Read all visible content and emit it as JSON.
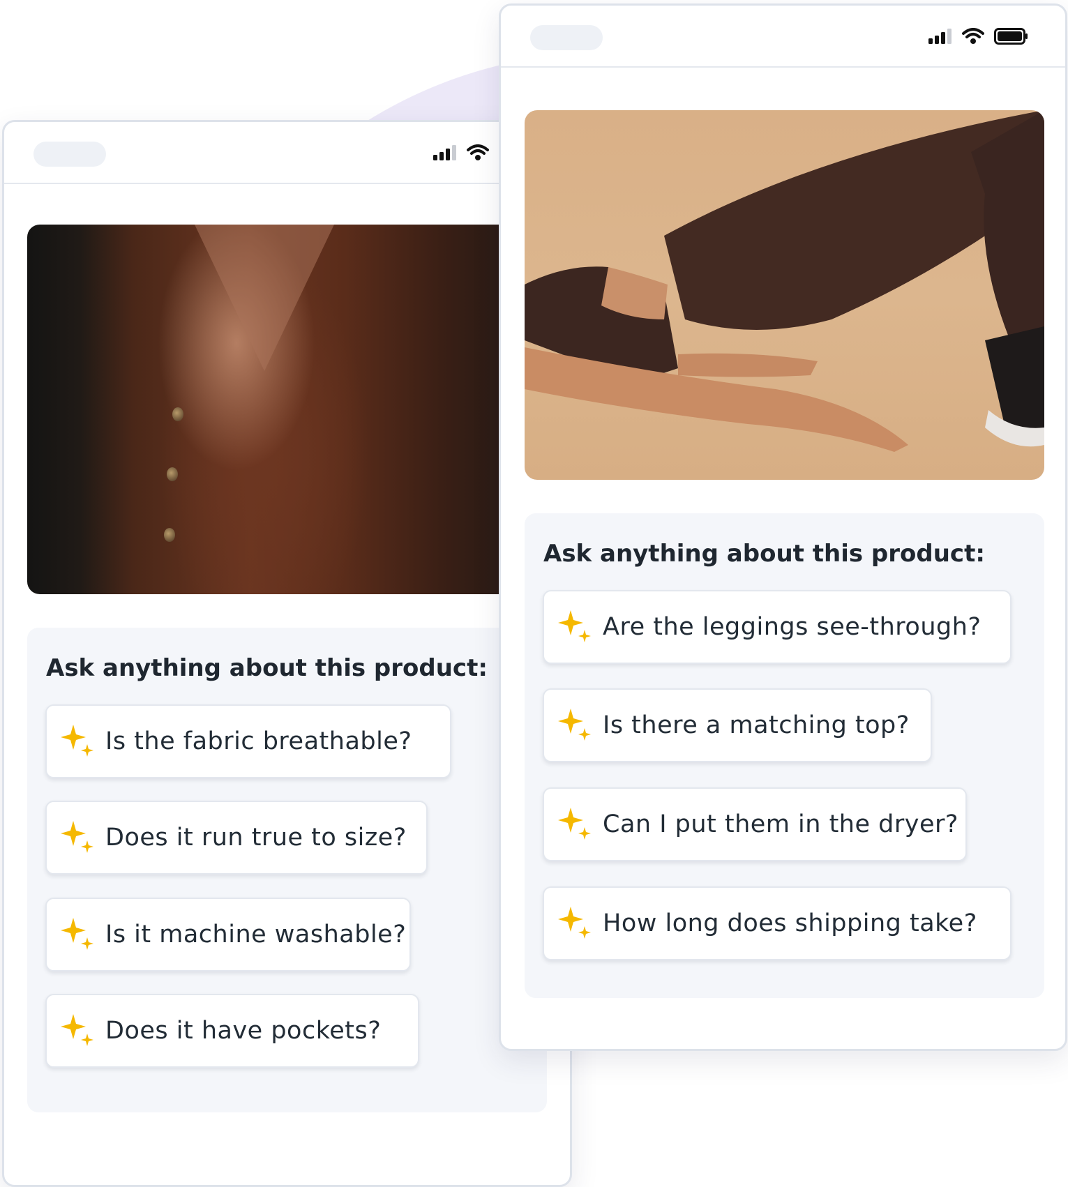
{
  "colors": {
    "sparkle": "#f5b800",
    "title": "#1f2730",
    "panel_bg": "#f4f6fa",
    "backdrop": "#ece8f8"
  },
  "left_phone": {
    "image": "brown-button-vest-photo",
    "ask_title": "Ask anything about this product:",
    "questions": [
      "Is the fabric breathable?",
      "Does it run true to size?",
      "Is it machine washable?",
      "Does it have pockets?"
    ]
  },
  "right_phone": {
    "image": "brown-leggings-photo",
    "ask_title": "Ask anything about this product:",
    "questions": [
      "Are the leggings see-through?",
      "Is there a matching top?",
      "Can I put them in the dryer?",
      "How long does shipping take?"
    ]
  }
}
